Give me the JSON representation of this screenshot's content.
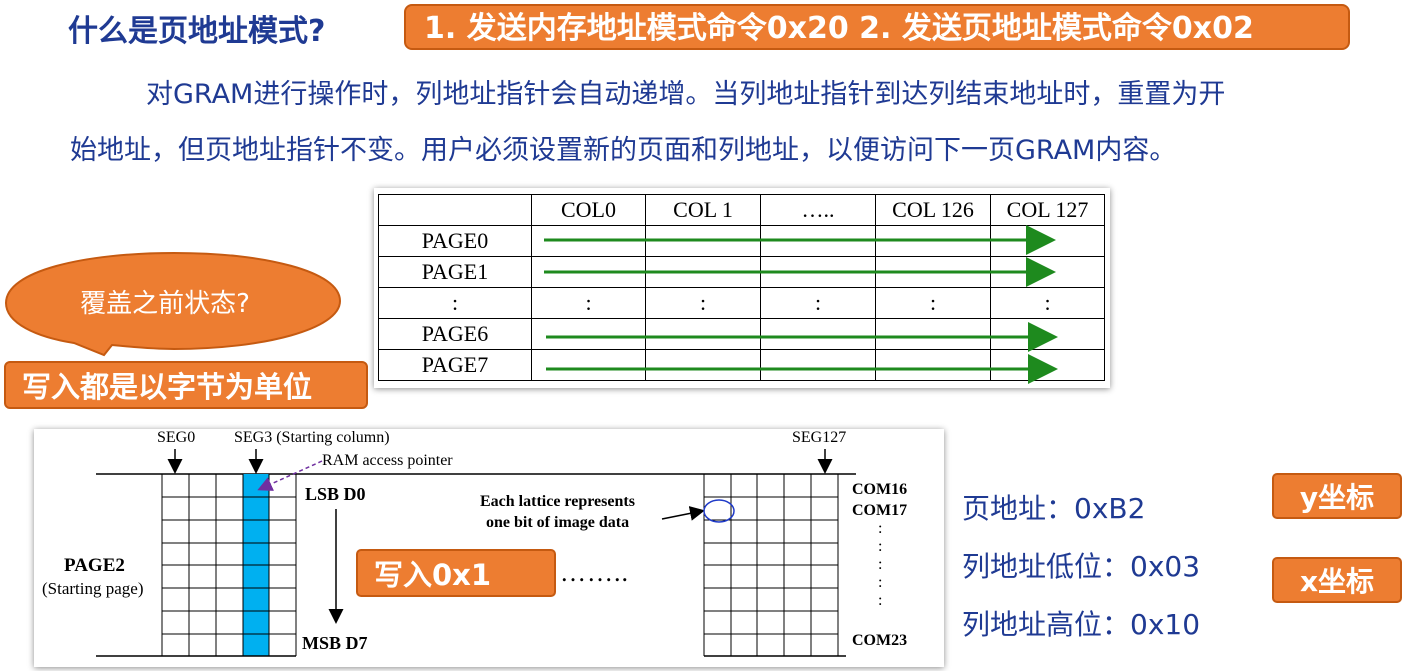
{
  "title": "什么是页地址模式?",
  "command_banner": "1. 发送内存地址模式命令0x20   2. 发送页地址模式命令0x02",
  "description": {
    "line1": "对GRAM进行操作时，列地址指针会自动递增。当列地址指针到达列结束地址时，重置为开",
    "line2": "始地址，但页地址指针不变。用户必须设置新的页面和列地址，以便访问下一页GRAM内容。"
  },
  "callout_text": "覆盖之前状态?",
  "byte_unit_banner": "写入都是以字节为单位",
  "page_table": {
    "columns": [
      "",
      "COL0",
      "COL 1",
      "…..",
      "COL 126",
      "COL 127"
    ],
    "rows": [
      "PAGE0",
      "PAGE1",
      ":",
      "PAGE6",
      "PAGE7"
    ],
    "ellipsis_cell": ":"
  },
  "diagram": {
    "seg0": "SEG0",
    "seg3": "SEG3 (Starting column)",
    "seg127": "SEG127",
    "pointer_label": "RAM access pointer",
    "lsb": "LSB D0",
    "msb": "MSB D7",
    "lattice_line1": "Each lattice represents",
    "lattice_line2": "one bit of image data",
    "page_label": "PAGE2",
    "page_sub": "(Starting page)",
    "com_top1": "COM16",
    "com_top2": "COM17",
    "com_bottom": "COM23",
    "write_banner": "写入0x1",
    "dots": "……..",
    "vdots": ":"
  },
  "address_info": {
    "page_addr": "页地址：0xB2",
    "col_low": "列地址低位：0x03",
    "col_high": "列地址高位：0x10"
  },
  "y_button": "y坐标",
  "x_button": "x坐标",
  "colors": {
    "accent_orange": "#ed7d31",
    "text_blue": "#1f3a93",
    "arrow_green": "#1e8a1e",
    "highlight_cyan": "#00b0f0"
  }
}
